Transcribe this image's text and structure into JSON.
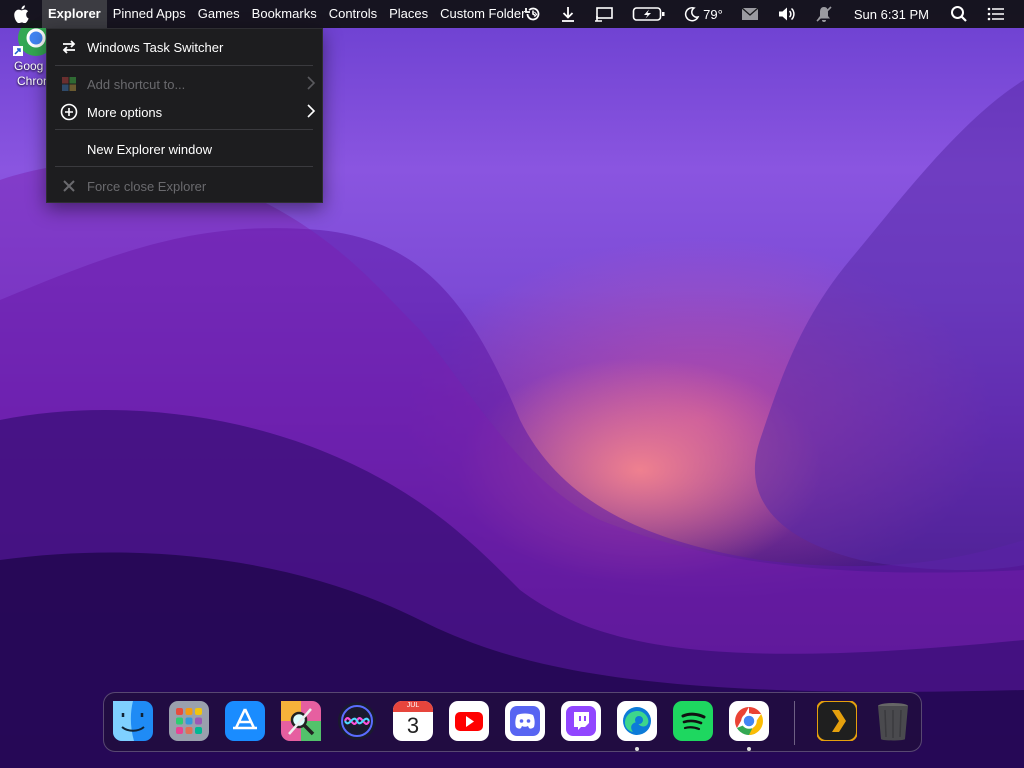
{
  "menubar": {
    "items": [
      {
        "label": "Explorer",
        "active": true
      },
      {
        "label": "Pinned Apps"
      },
      {
        "label": "Games"
      },
      {
        "label": "Bookmarks"
      },
      {
        "label": "Controls"
      },
      {
        "label": "Places"
      },
      {
        "label": "Custom Folder"
      }
    ],
    "overflow_glyph": "›",
    "tray": {
      "icons": [
        "history-icon",
        "download-icon",
        "display-icon",
        "battery-icon",
        "weather-icon",
        "mail-icon",
        "volume-icon",
        "notifications-off-icon",
        "search-icon",
        "list-icon"
      ],
      "temperature": "79°",
      "clock": "Sun 6:31 PM"
    }
  },
  "menu": {
    "items": [
      {
        "label": "Windows Task Switcher",
        "icon": "switch-arrows-icon",
        "enabled": true
      },
      {
        "label": "Add shortcut to...",
        "icon": "windows-logo-icon",
        "enabled": false,
        "submenu": true
      },
      {
        "label": "More options",
        "icon": "plus-circle-icon",
        "enabled": true,
        "submenu": true
      },
      {
        "label": "New Explorer window",
        "enabled": true
      },
      {
        "label": "Force close Explorer",
        "icon": "close-icon",
        "enabled": false
      }
    ]
  },
  "desktop": {
    "shortcut_label_line1": "Goog",
    "shortcut_label_line2": "Chron"
  },
  "dock": {
    "apps": [
      {
        "name": "Finder",
        "icon": "finder-icon",
        "running": false
      },
      {
        "name": "Launchpad",
        "icon": "launchpad-icon",
        "running": false
      },
      {
        "name": "App Store",
        "icon": "app-store-icon",
        "running": false
      },
      {
        "name": "Utilities",
        "icon": "utilities-icon",
        "running": false
      },
      {
        "name": "Siri",
        "icon": "siri-icon",
        "running": false
      },
      {
        "name": "Calendar",
        "icon": "calendar-icon",
        "running": false,
        "month": "JUL",
        "day": "3"
      },
      {
        "name": "YouTube",
        "icon": "youtube-icon",
        "running": false
      },
      {
        "name": "Discord",
        "icon": "discord-icon",
        "running": false
      },
      {
        "name": "Twitch",
        "icon": "twitch-icon",
        "running": false
      },
      {
        "name": "Edge",
        "icon": "edge-icon",
        "running": true
      },
      {
        "name": "Spotify",
        "icon": "spotify-icon",
        "running": false
      },
      {
        "name": "Chrome",
        "icon": "chrome-icon",
        "running": true
      },
      {
        "name": "Plex",
        "icon": "plex-icon",
        "running": false
      },
      {
        "name": "Trash",
        "icon": "trash-icon",
        "running": false
      }
    ]
  }
}
